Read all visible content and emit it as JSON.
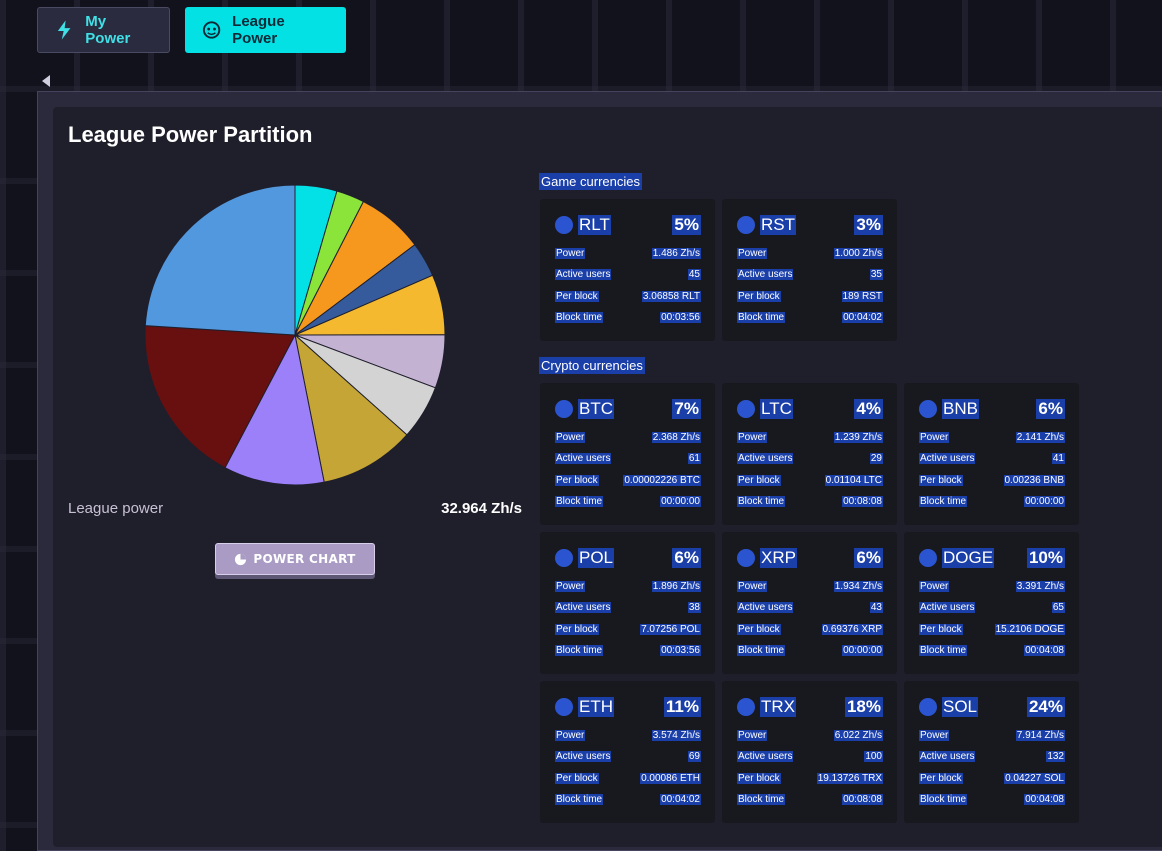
{
  "tabs": [
    {
      "label": "My Power",
      "icon": "lightning-icon",
      "active": false
    },
    {
      "label": "League Power",
      "icon": "league-icon",
      "active": true
    }
  ],
  "page_title": "League Power Partition",
  "league_power": {
    "label": "League power",
    "value": "32.964 Zh/s"
  },
  "power_chart_button": "POWER CHART",
  "sections": {
    "game": "Game currencies",
    "crypto": "Crypto currencies"
  },
  "row_labels": {
    "power": "Power",
    "users": "Active users",
    "per_block": "Per block",
    "block_time": "Block time"
  },
  "colors": {
    "accent": "#03e1e4",
    "highlight": "#1a3fa8",
    "panel": "#1f1f2c",
    "card": "#18181f"
  },
  "game_currencies": [
    {
      "name": "RLT",
      "pct": "5%",
      "power": "1.486 Zh/s",
      "users": "45",
      "per_block": "3.06858 RLT",
      "block_time": "00:03:56"
    },
    {
      "name": "RST",
      "pct": "3%",
      "power": "1.000 Zh/s",
      "users": "35",
      "per_block": "189 RST",
      "block_time": "00:04:02"
    }
  ],
  "crypto_currencies": [
    {
      "name": "BTC",
      "pct": "7%",
      "power": "2.368 Zh/s",
      "users": "61",
      "per_block": "0.00002226 BTC",
      "block_time": "00:00:00"
    },
    {
      "name": "LTC",
      "pct": "4%",
      "power": "1.239 Zh/s",
      "users": "29",
      "per_block": "0.01104 LTC",
      "block_time": "00:08:08"
    },
    {
      "name": "BNB",
      "pct": "6%",
      "power": "2.141 Zh/s",
      "users": "41",
      "per_block": "0.00236 BNB",
      "block_time": "00:00:00"
    },
    {
      "name": "POL",
      "pct": "6%",
      "power": "1.896 Zh/s",
      "users": "38",
      "per_block": "7.07256 POL",
      "block_time": "00:03:56"
    },
    {
      "name": "XRP",
      "pct": "6%",
      "power": "1.934 Zh/s",
      "users": "43",
      "per_block": "0.69376 XRP",
      "block_time": "00:00:00"
    },
    {
      "name": "DOGE",
      "pct": "10%",
      "power": "3.391 Zh/s",
      "users": "65",
      "per_block": "15.2106 DOGE",
      "block_time": "00:04:08"
    },
    {
      "name": "ETH",
      "pct": "11%",
      "power": "3.574 Zh/s",
      "users": "69",
      "per_block": "0.00086 ETH",
      "block_time": "00:04:02"
    },
    {
      "name": "TRX",
      "pct": "18%",
      "power": "6.022 Zh/s",
      "users": "100",
      "per_block": "19.13726 TRX",
      "block_time": "00:08:08"
    },
    {
      "name": "SOL",
      "pct": "24%",
      "power": "7.914 Zh/s",
      "users": "132",
      "per_block": "0.04227 SOL",
      "block_time": "00:04:08"
    }
  ],
  "chart_data": {
    "type": "pie",
    "title": "",
    "categories": [
      "RLT",
      "RST",
      "BTC",
      "LTC",
      "BNB",
      "POL",
      "XRP",
      "DOGE",
      "ETH",
      "TRX",
      "SOL"
    ],
    "values": [
      1.486,
      1.0,
      2.368,
      1.239,
      2.141,
      1.896,
      1.934,
      3.391,
      3.574,
      6.022,
      7.914
    ],
    "colors": [
      "#04e1e6",
      "#8be43a",
      "#f6971e",
      "#355b9c",
      "#f4b92f",
      "#c4b2d2",
      "#d3d3d3",
      "#c4a536",
      "#9c80f9",
      "#680f0f",
      "#5198de"
    ]
  }
}
